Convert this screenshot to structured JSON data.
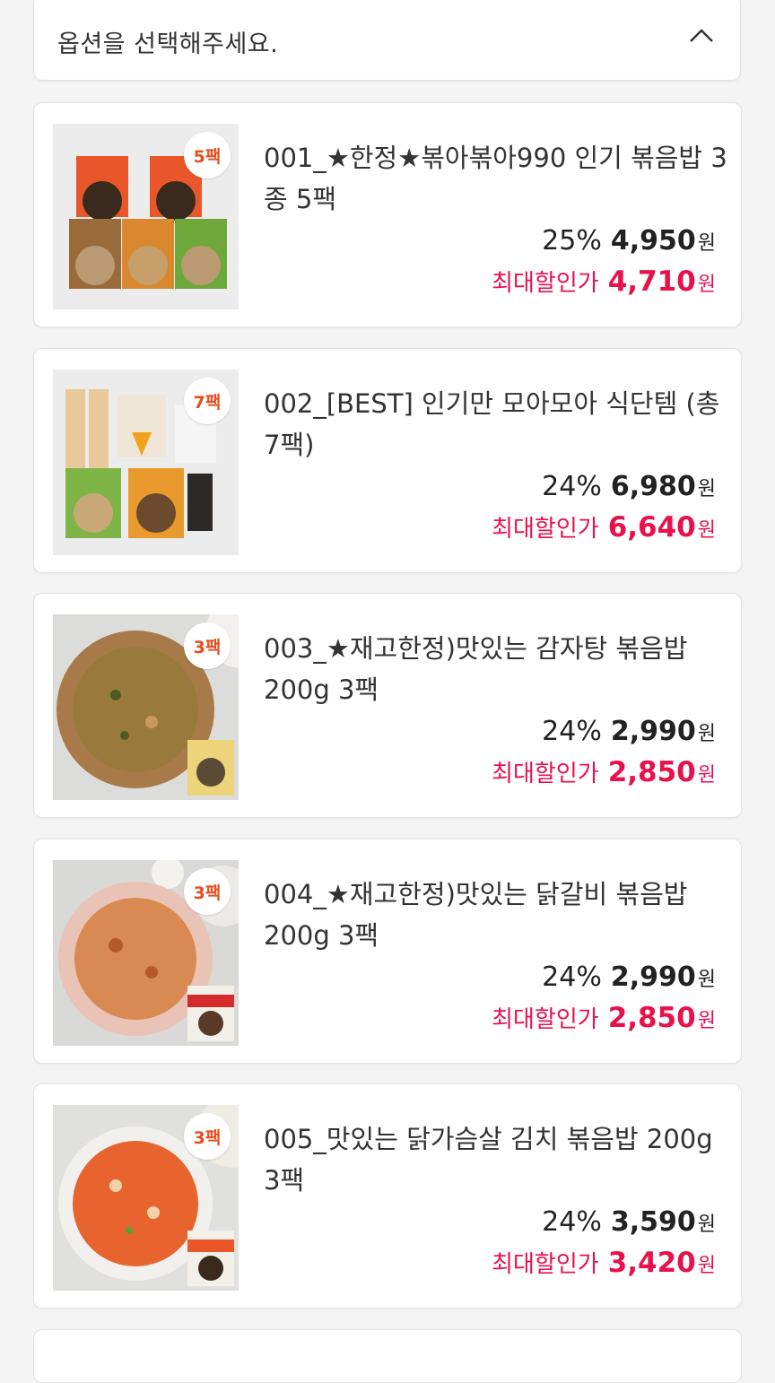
{
  "option_selector": {
    "placeholder": "옵션을 선택해주세요.",
    "icon": "chevron-up-icon"
  },
  "products": [
    {
      "title": "001_★한정★볶아볶아990 인기 볶음밥 3종 5팩",
      "pack": "5팩",
      "rate": "25%",
      "price": "4,950",
      "max_label": "최대할인가",
      "max_price": "4,710",
      "won": "원"
    },
    {
      "title": "002_[BEST] 인기만 모아모아 식단템 (총7팩)",
      "pack": "7팩",
      "rate": "24%",
      "price": "6,980",
      "max_label": "최대할인가",
      "max_price": "6,640",
      "won": "원"
    },
    {
      "title": "003_★재고한정)맛있는 감자탕 볶음밥 200g 3팩",
      "pack": "3팩",
      "rate": "24%",
      "price": "2,990",
      "max_label": "최대할인가",
      "max_price": "2,850",
      "won": "원"
    },
    {
      "title": "004_★재고한정)맛있는 닭갈비 볶음밥 200g 3팩",
      "pack": "3팩",
      "rate": "24%",
      "price": "2,990",
      "max_label": "최대할인가",
      "max_price": "2,850",
      "won": "원"
    },
    {
      "title": "005_맛있는 닭가슴살 김치 볶음밥 200g 3팩",
      "pack": "3팩",
      "rate": "24%",
      "price": "3,590",
      "max_label": "최대할인가",
      "max_price": "3,420",
      "won": "원"
    }
  ],
  "colors": {
    "accent": "#e8114c",
    "badge": "#e84d1c",
    "background": "#f4f4f5"
  }
}
